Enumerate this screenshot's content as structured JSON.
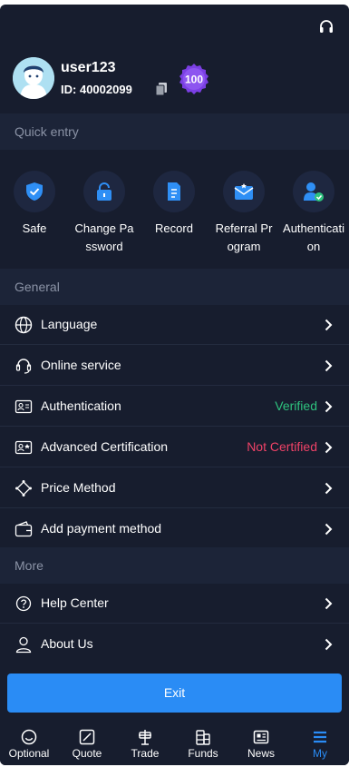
{
  "header": {
    "support_icon": "headset-icon"
  },
  "profile": {
    "username": "user123",
    "id_label": "ID:",
    "id_value": "40002099",
    "badge_value": "100"
  },
  "quick_entry": {
    "title": "Quick entry",
    "items": [
      {
        "label": "Safe",
        "icon": "shield-icon"
      },
      {
        "label": "Change Password",
        "icon": "lock-icon"
      },
      {
        "label": "Record",
        "icon": "document-icon"
      },
      {
        "label": "Referral Program",
        "icon": "envelope-icon"
      },
      {
        "label": "Authentication",
        "icon": "user-check-icon"
      }
    ]
  },
  "general": {
    "title": "General",
    "items": [
      {
        "label": "Language",
        "icon": "globe-icon",
        "status": ""
      },
      {
        "label": "Online service",
        "icon": "headset-icon",
        "status": ""
      },
      {
        "label": "Authentication",
        "icon": "id-card-icon",
        "status": "Verified"
      },
      {
        "label": "Advanced Certification",
        "icon": "id-card-star-icon",
        "status": "Not Certified"
      },
      {
        "label": "Price Method",
        "icon": "diamond-icon",
        "status": ""
      },
      {
        "label": "Add payment method",
        "icon": "wallet-icon",
        "status": ""
      }
    ]
  },
  "more": {
    "title": "More",
    "items": [
      {
        "label": "Help Center",
        "icon": "question-circle-icon"
      },
      {
        "label": "About Us",
        "icon": "person-icon"
      }
    ]
  },
  "exit_label": "Exit",
  "tabs": [
    {
      "label": "Optional",
      "icon": "smiley-icon"
    },
    {
      "label": "Quote",
      "icon": "chart-square-icon"
    },
    {
      "label": "Trade",
      "icon": "scale-icon"
    },
    {
      "label": "Funds",
      "icon": "coins-icon"
    },
    {
      "label": "News",
      "icon": "newspaper-icon"
    },
    {
      "label": "My",
      "icon": "menu-icon",
      "active": true
    }
  ],
  "colors": {
    "background": "#171d2e",
    "section": "#1c2438",
    "accent": "#2a8cf5",
    "verified": "#2ec27e",
    "not_certified": "#ef4267",
    "badge": "#7b3fe4"
  }
}
